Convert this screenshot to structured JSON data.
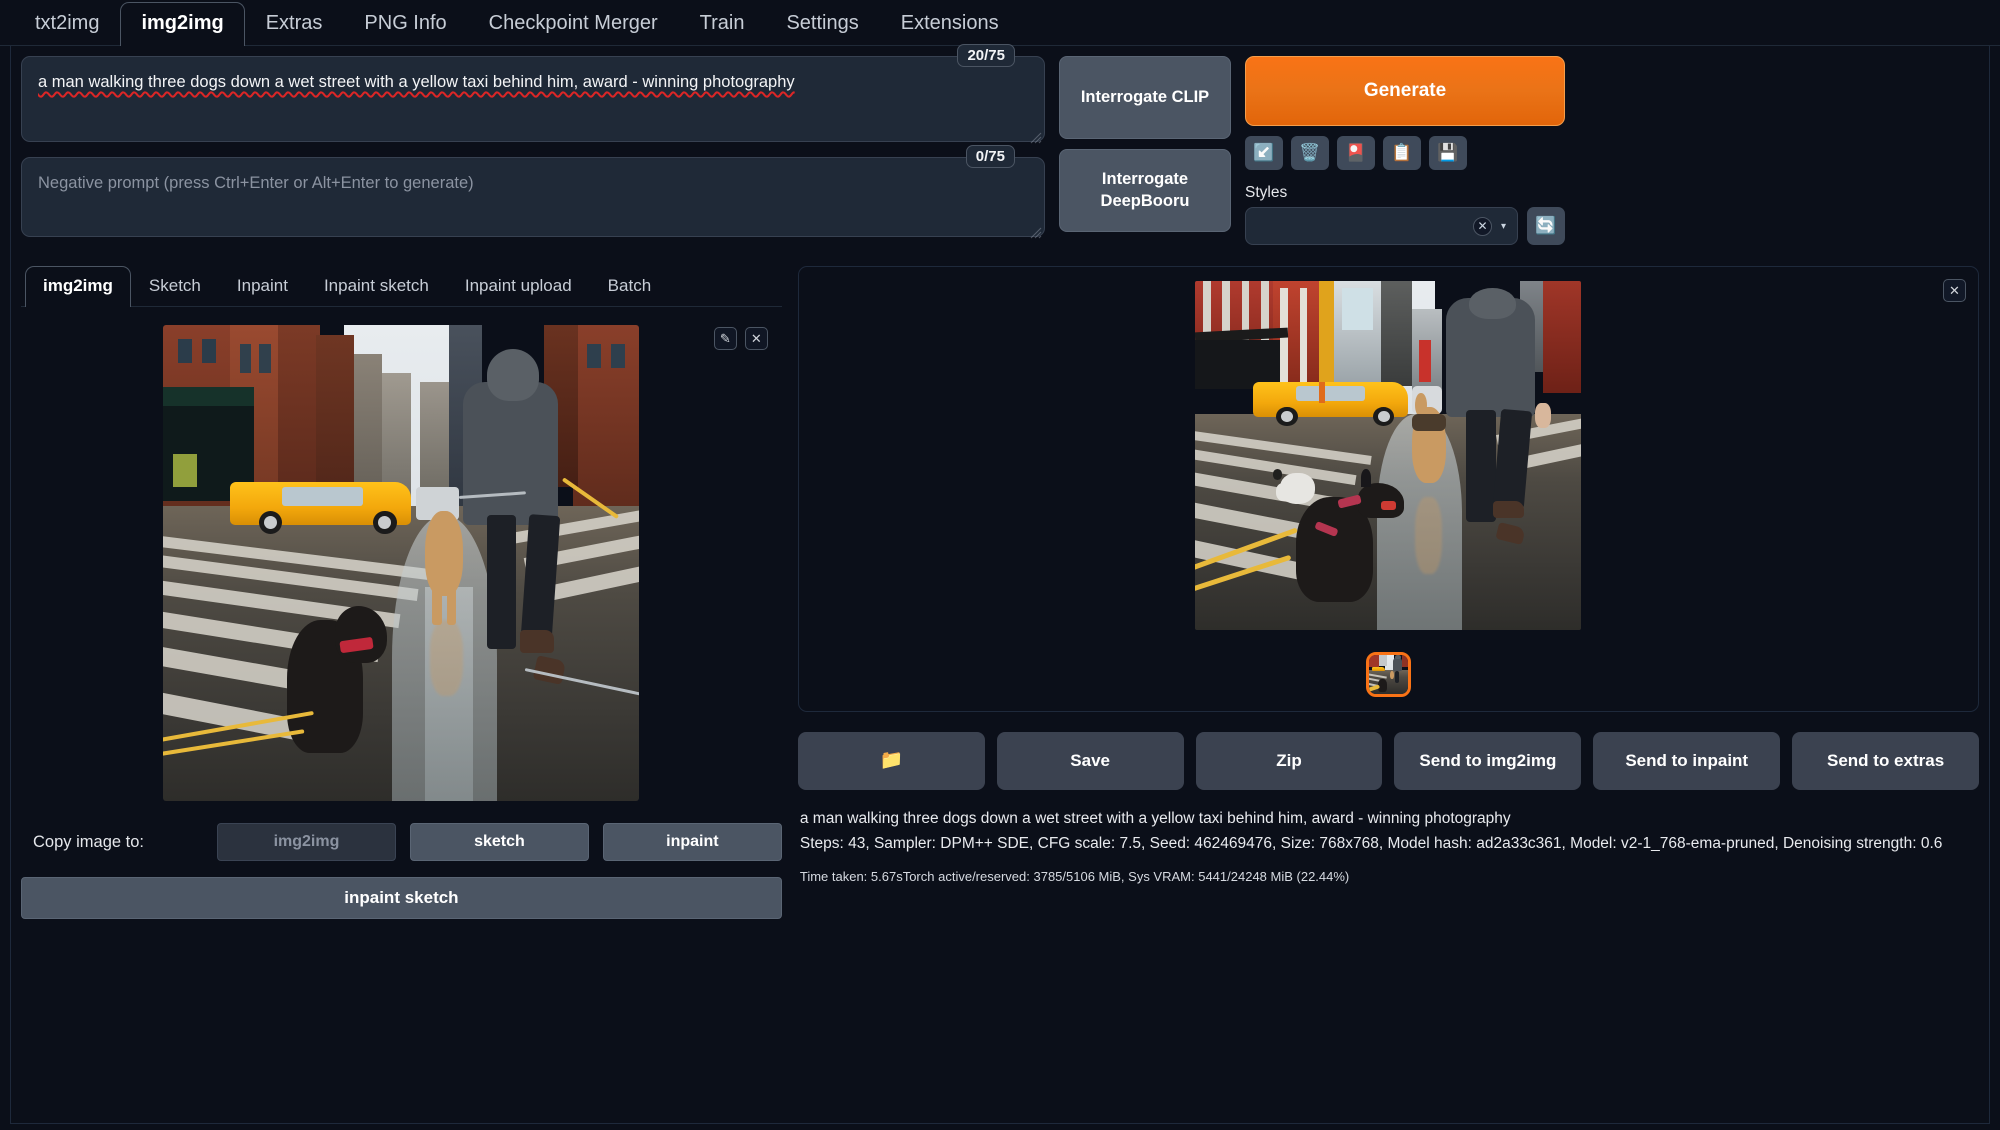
{
  "app": {
    "accent_orange": "#f97316",
    "background": "#0b0f19",
    "panel": "#1f2937",
    "button_slate": "#4b5563"
  },
  "top_tabs": [
    {
      "label": "txt2img",
      "active": false
    },
    {
      "label": "img2img",
      "active": true
    },
    {
      "label": "Extras",
      "active": false
    },
    {
      "label": "PNG Info",
      "active": false
    },
    {
      "label": "Checkpoint Merger",
      "active": false
    },
    {
      "label": "Train",
      "active": false
    },
    {
      "label": "Settings",
      "active": false
    },
    {
      "label": "Extensions",
      "active": false
    }
  ],
  "prompt": {
    "value": "a man walking three dogs down a wet street with a yellow taxi behind him, award - winning photography",
    "token_counter": "20/75"
  },
  "negative_prompt": {
    "value": "",
    "placeholder": "Negative prompt (press Ctrl+Enter or Alt+Enter to generate)",
    "token_counter": "0/75"
  },
  "interrogate": {
    "clip_label": "Interrogate CLIP",
    "deepbooru_label": "Interrogate DeepBooru"
  },
  "generate": {
    "label": "Generate"
  },
  "tool_buttons": [
    {
      "icon": "↙️",
      "name": "restore-progress-icon"
    },
    {
      "icon": "🗑️",
      "name": "clear-prompt-icon"
    },
    {
      "icon": "🎴",
      "name": "show-extra-networks-icon"
    },
    {
      "icon": "📋",
      "name": "apply-style-icon"
    },
    {
      "icon": "💾",
      "name": "save-style-icon"
    }
  ],
  "styles": {
    "label": "Styles",
    "value": "",
    "clear_icon": "✕",
    "caret_icon": "▾",
    "refresh_icon": "🔄"
  },
  "img2img_subtabs": [
    {
      "label": "img2img",
      "active": true
    },
    {
      "label": "Sketch",
      "active": false
    },
    {
      "label": "Inpaint",
      "active": false
    },
    {
      "label": "Inpaint sketch",
      "active": false
    },
    {
      "label": "Inpaint upload",
      "active": false
    },
    {
      "label": "Batch",
      "active": false
    }
  ],
  "source_image": {
    "edit_icon": "✎",
    "close_icon": "✕",
    "alt": "a man walking three dogs down a wet city street with a yellow taxi"
  },
  "copy_image_to": {
    "label": "Copy image to:",
    "buttons": [
      {
        "label": "img2img",
        "disabled": true
      },
      {
        "label": "sketch",
        "disabled": false
      },
      {
        "label": "inpaint",
        "disabled": false
      }
    ],
    "wide_button": "inpaint sketch"
  },
  "result": {
    "close_icon": "✕",
    "alt": "generated image of a man walking three dogs on a wet street with yellow taxi",
    "thumbnail_selected": true
  },
  "result_actions": [
    {
      "label": "📁",
      "name": "open-folder-button",
      "icon_only": true
    },
    {
      "label": "Save",
      "name": "save-button",
      "icon_only": false
    },
    {
      "label": "Zip",
      "name": "zip-button",
      "icon_only": false
    },
    {
      "label": "Send to img2img",
      "name": "send-to-img2img-button",
      "icon_only": false
    },
    {
      "label": "Send to inpaint",
      "name": "send-to-inpaint-button",
      "icon_only": false
    },
    {
      "label": "Send to extras",
      "name": "send-to-extras-button",
      "icon_only": false
    }
  ],
  "generation_info": {
    "prompt_line": "a man walking three dogs down a wet street with a yellow taxi behind him, award - winning photography",
    "params_line": "Steps: 43, Sampler: DPM++ SDE, CFG scale: 7.5, Seed: 462469476, Size: 768x768, Model hash: ad2a33c361, Model: v2-1_768-ema-pruned, Denoising strength: 0.6",
    "timing_line": "Time taken: 5.67sTorch active/reserved: 3785/5106 MiB, Sys VRAM: 5441/24248 MiB (22.44%)",
    "parameters": {
      "steps": 43,
      "sampler": "DPM++ SDE",
      "cfg_scale": 7.5,
      "seed": 462469476,
      "size": "768x768",
      "model_hash": "ad2a33c361",
      "model": "v2-1_768-ema-pruned",
      "denoising_strength": 0.6,
      "time_taken": "5.67s",
      "torch_active_reserved": "3785/5106 MiB",
      "sys_vram": "5441/24248 MiB",
      "vram_percent": "22.44%"
    }
  }
}
